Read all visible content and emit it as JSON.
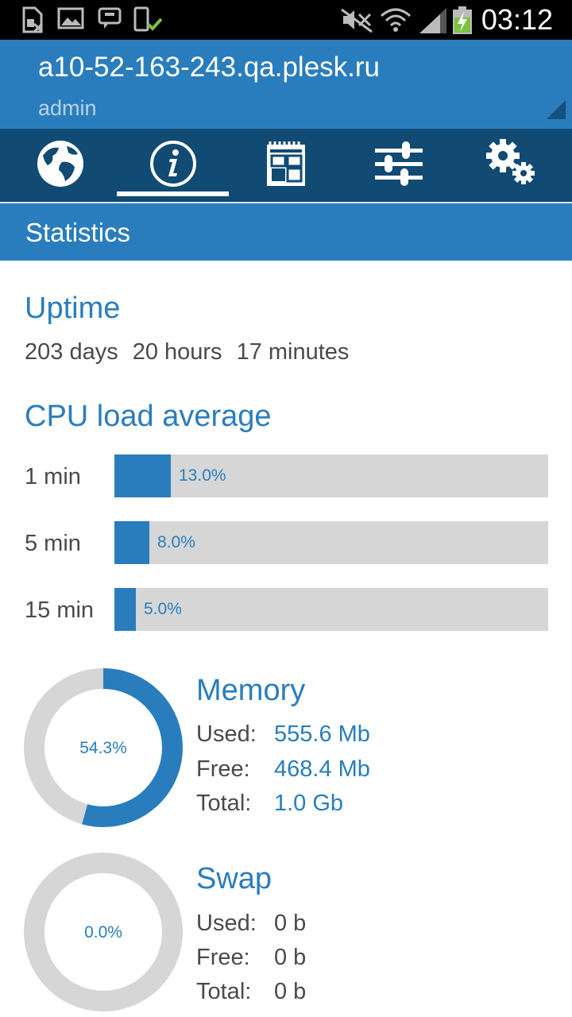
{
  "status_bar": {
    "time": "03:12"
  },
  "header": {
    "host": "a10-52-163-243.qa.plesk.ru",
    "user": "admin"
  },
  "tabs": [
    {
      "icon": "globe-icon"
    },
    {
      "icon": "info-icon",
      "active": true
    },
    {
      "icon": "calendar-icon"
    },
    {
      "icon": "sliders-icon"
    },
    {
      "icon": "gears-icon"
    }
  ],
  "section_title": "Statistics",
  "uptime": {
    "title": "Uptime",
    "days": "203 days",
    "hours": "20 hours",
    "minutes": "17 minutes"
  },
  "cpu": {
    "title": "CPU load average",
    "rows": [
      {
        "label": "1 min",
        "value_text": "13.0%",
        "percent": 13.0
      },
      {
        "label": "5 min",
        "value_text": "8.0%",
        "percent": 8.0
      },
      {
        "label": "15 min",
        "value_text": "5.0%",
        "percent": 5.0
      }
    ]
  },
  "memory": {
    "title": "Memory",
    "percent_text": "54.3%",
    "percent": 54.3,
    "used_label": "Used:",
    "used": "555.6 Mb",
    "free_label": "Free:",
    "free": "468.4 Mb",
    "total_label": "Total:",
    "total": "1.0 Gb"
  },
  "swap": {
    "title": "Swap",
    "percent_text": "0.0%",
    "percent": 0.0,
    "used_label": "Used:",
    "used": "0 b",
    "free_label": "Free:",
    "free": "0 b",
    "total_label": "Total:",
    "total": "0 b"
  },
  "colors": {
    "accent": "#2a7dbd",
    "tab_bar": "#114a73",
    "track": "#d6d6d6"
  }
}
